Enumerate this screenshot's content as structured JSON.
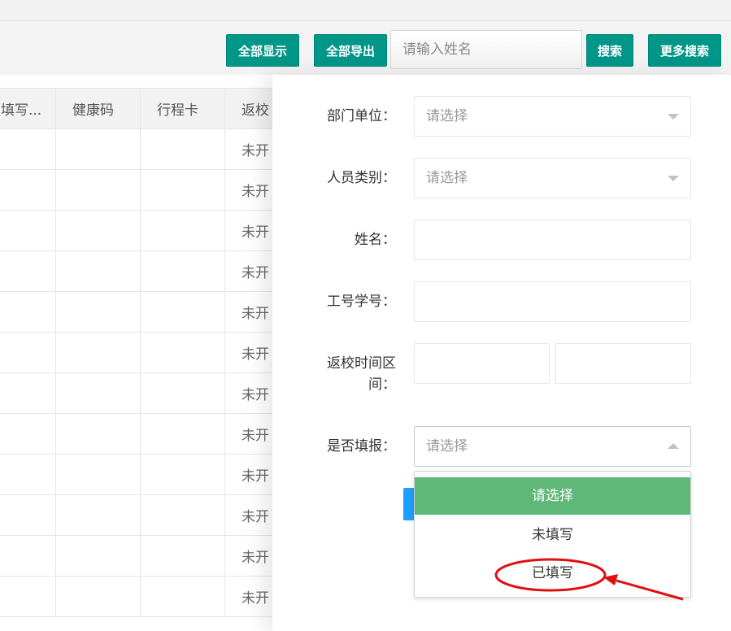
{
  "toolbar": {
    "show_all": "全部显示",
    "export_all": "全部导出",
    "search_placeholder": "请输入姓名",
    "search": "搜索",
    "more_search": "更多搜索"
  },
  "table": {
    "headers": [
      "填写...",
      "健康码",
      "行程卡",
      "返校"
    ],
    "rows": [
      [
        "",
        "",
        "",
        "未开"
      ],
      [
        "",
        "",
        "",
        "未开"
      ],
      [
        "",
        "",
        "",
        "未开"
      ],
      [
        "",
        "",
        "",
        "未开"
      ],
      [
        "",
        "",
        "",
        "未开"
      ],
      [
        "",
        "",
        "",
        "未开"
      ],
      [
        "",
        "",
        "",
        "未开"
      ],
      [
        "",
        "",
        "",
        "未开"
      ],
      [
        "",
        "",
        "",
        "未开"
      ],
      [
        "",
        "",
        "",
        "未开"
      ],
      [
        "",
        "",
        "",
        "未开"
      ],
      [
        "",
        "",
        "",
        "未开"
      ]
    ]
  },
  "form": {
    "dept_label": "部门单位：",
    "dept_value": "请选择",
    "category_label": "人员类别：",
    "category_value": "请选择",
    "name_label": "姓名：",
    "id_label": "工号学号：",
    "return_label_1": "返校时间区",
    "return_label_2": "间：",
    "filled_label": "是否填报：",
    "filled_value": "请选择"
  },
  "dropdown": {
    "options": [
      "请选择",
      "未填写",
      "已填写"
    ],
    "selected_index": 0
  },
  "colors": {
    "primary_button": "#009688",
    "selected_option": "#5fb878",
    "annotation_red": "#e01010",
    "blue_button": "#1e9fff"
  }
}
